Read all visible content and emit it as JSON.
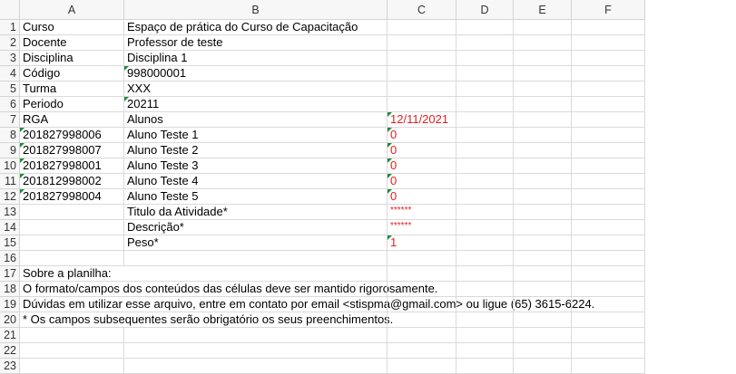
{
  "columns": [
    "A",
    "B",
    "C",
    "D",
    "E",
    "F"
  ],
  "rows": [
    {
      "num": "1",
      "A": "Curso",
      "B": "Espaço de prática do Curso de Capacitação",
      "C": ""
    },
    {
      "num": "2",
      "A": "Docente",
      "B": "Professor de teste",
      "C": ""
    },
    {
      "num": "3",
      "A": "Disciplina",
      "B": "Disciplina 1",
      "C": ""
    },
    {
      "num": "4",
      "A": "Código",
      "B": "998000001",
      "C": ""
    },
    {
      "num": "5",
      "A": "Turma",
      "B": "XXX",
      "C": ""
    },
    {
      "num": "6",
      "A": "Periodo",
      "B": "20211",
      "C": ""
    },
    {
      "num": "7",
      "A": "RGA",
      "B": "Alunos",
      "C": "12/11/2021"
    },
    {
      "num": "8",
      "A": "201827998006",
      "B": "Aluno Teste 1",
      "C": "0"
    },
    {
      "num": "9",
      "A": "201827998007",
      "B": "Aluno Teste 2",
      "C": "0"
    },
    {
      "num": "10",
      "A": "201827998001",
      "B": "Aluno Teste 3",
      "C": "0"
    },
    {
      "num": "11",
      "A": "201812998002",
      "B": "Aluno Teste 4",
      "C": "0"
    },
    {
      "num": "12",
      "A": "201827998004",
      "B": "Aluno Teste 5",
      "C": "0"
    },
    {
      "num": "13",
      "A": "",
      "B": "Titulo da Atividade*",
      "C": "******"
    },
    {
      "num": "14",
      "A": "",
      "B": "Descrição*",
      "C": "******"
    },
    {
      "num": "15",
      "A": "",
      "B": "Peso*",
      "C": "1"
    },
    {
      "num": "16",
      "A": "",
      "B": "",
      "C": ""
    },
    {
      "num": "17",
      "A": "Sobre a planilha:",
      "B": "",
      "C": ""
    },
    {
      "num": "18",
      "A": "O formato/campos dos conteúdos das células deve ser mantido rigorosamente.",
      "B": "",
      "C": ""
    },
    {
      "num": "19",
      "A": "Dúvidas em utilizar esse arquivo, entre em contato por email <stispma@gmail.com> ou ligue (65) 3615-6224.",
      "B": "",
      "C": ""
    },
    {
      "num": "20",
      "A": "* Os campos subsequentes serão obrigatório os seus preenchimentos.",
      "B": "",
      "C": ""
    },
    {
      "num": "21",
      "A": "",
      "B": "",
      "C": ""
    },
    {
      "num": "22",
      "A": "",
      "B": "",
      "C": ""
    },
    {
      "num": "23",
      "A": "",
      "B": "",
      "C": ""
    }
  ],
  "colors": {
    "red_text": "#e02020",
    "error_indicator": "#1e8c3a",
    "header_bg": "#f7f7f7",
    "grid": "#dadada"
  }
}
